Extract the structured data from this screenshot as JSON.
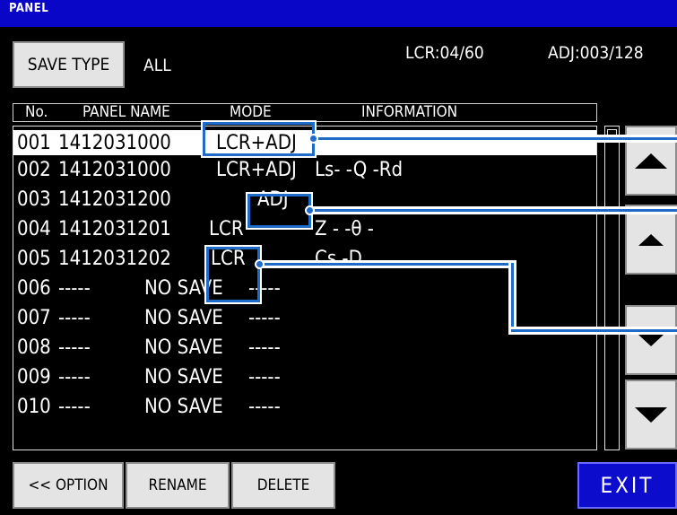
{
  "window": {
    "title": "PANEL"
  },
  "header": {
    "save_type_button": "SAVE TYPE",
    "save_type_value": "ALL",
    "lcr_count": "LCR:04/60",
    "adj_count": "ADJ:003/128"
  },
  "columns": {
    "no": "No.",
    "panel_name": "PANEL NAME",
    "mode": "MODE",
    "information": "INFORMATION"
  },
  "rows": [
    {
      "no": "001",
      "name": "1412031000",
      "mode": "LCR+ADJ",
      "info": "",
      "selected": true
    },
    {
      "no": "002",
      "name": "1412031000",
      "mode": "LCR+ADJ",
      "info": "Ls-   -Q -Rd"
    },
    {
      "no": "003",
      "name": "1412031200",
      "mode": "ADJ",
      "info": ""
    },
    {
      "no": "004",
      "name": "1412031201",
      "mode": "LCR",
      "info": "Z -   -θ -"
    },
    {
      "no": "005",
      "name": "1412031202",
      "mode": "LCR",
      "info": "Cs   -D"
    },
    {
      "no": "006",
      "name": "-----",
      "mode": "NO SAVE",
      "info": "-----"
    },
    {
      "no": "007",
      "name": "-----",
      "mode": "NO SAVE",
      "info": "-----"
    },
    {
      "no": "008",
      "name": "-----",
      "mode": "NO SAVE",
      "info": "-----"
    },
    {
      "no": "009",
      "name": "-----",
      "mode": "NO SAVE",
      "info": "-----"
    },
    {
      "no": "010",
      "name": "-----",
      "mode": "NO SAVE",
      "info": "-----"
    }
  ],
  "callouts": {
    "c1": "LCR+ADJ",
    "c2": "ADJ",
    "c3": "LCR"
  },
  "footer": {
    "option": "<< OPTION",
    "rename": "RENAME",
    "delete": "DELETE",
    "exit": "EXIT"
  },
  "icons": {
    "page_up": "double-up-arrow-icon",
    "up": "up-arrow-icon",
    "down": "down-arrow-icon",
    "page_down": "double-down-arrow-icon"
  },
  "colors": {
    "titlebar": "#0a06c8",
    "callout": "#1e6bc8",
    "exit": "#0c0ccc"
  }
}
